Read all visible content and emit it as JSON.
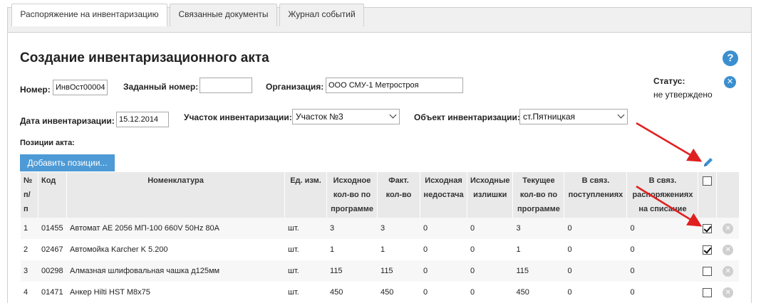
{
  "tabs": [
    {
      "label": "Распоряжение на инвентаризацию",
      "active": true
    },
    {
      "label": "Связанные документы",
      "active": false
    },
    {
      "label": "Журнал событий",
      "active": false
    }
  ],
  "page_title": "Создание инвентаризационного акта",
  "help_icon": "?",
  "close_icon": "✕",
  "form": {
    "number_label": "Номер:",
    "number_value": "ИнвОст00004",
    "assigned_number_label": "Заданный номер:",
    "assigned_number_value": "",
    "organization_label": "Организация:",
    "organization_value": "ООО СМУ-1 Метростроя",
    "status_label": "Статус:",
    "status_value": "не утверждено",
    "date_label": "Дата инвентаризации:",
    "date_value": "15.12.2014",
    "section_label": "Участок инвентаризации:",
    "section_value": "Участок №3",
    "object_label": "Объект инвентаризации:",
    "object_value": "ст.Пятницкая",
    "positions_label": "Позиции акта:",
    "add_button": "Добавить позиции..."
  },
  "table": {
    "headers": {
      "num": "№ п/п",
      "code": "Код",
      "nomenclature": "Номенклатура",
      "unit": "Ед. изм.",
      "initial_qty": "Исходное кол-во по программе",
      "actual_qty": "Факт. кол-во",
      "initial_shortage": "Исходная недостача",
      "initial_surplus": "Исходные излишки",
      "current_qty": "Текущее кол-во по программе",
      "linked_receipts": "В связ. поступлениях",
      "linked_writeoff": "В связ. распоряжениях на списание"
    },
    "rows": [
      {
        "num": "1",
        "code": "01455",
        "name": "Автомат АЕ 2056 МП-100 660V 50Hz 80A",
        "unit": "шт.",
        "initial_qty": "3",
        "actual_qty": "3",
        "shortage": "0",
        "surplus": "0",
        "current_qty": "3",
        "receipts": "0",
        "writeoff": "0",
        "checked": true
      },
      {
        "num": "2",
        "code": "02467",
        "name": "Автомойка Karcher K 5.200",
        "unit": "шт.",
        "initial_qty": "1",
        "actual_qty": "1",
        "shortage": "0",
        "surplus": "0",
        "current_qty": "1",
        "receipts": "0",
        "writeoff": "0",
        "checked": true
      },
      {
        "num": "3",
        "code": "00298",
        "name": "Алмазная шлифовальная чашка д125мм",
        "unit": "шт.",
        "initial_qty": "115",
        "actual_qty": "115",
        "shortage": "0",
        "surplus": "0",
        "current_qty": "115",
        "receipts": "0",
        "writeoff": "0",
        "checked": false
      },
      {
        "num": "4",
        "code": "01471",
        "name": "Анкер Hilti HST M8x75",
        "unit": "шт.",
        "initial_qty": "450",
        "actual_qty": "450",
        "shortage": "0",
        "surplus": "0",
        "current_qty": "450",
        "receipts": "0",
        "writeoff": "0",
        "checked": false
      }
    ]
  },
  "colors": {
    "accent": "#4d9ad6",
    "annotation_arrow": "#e02020"
  }
}
